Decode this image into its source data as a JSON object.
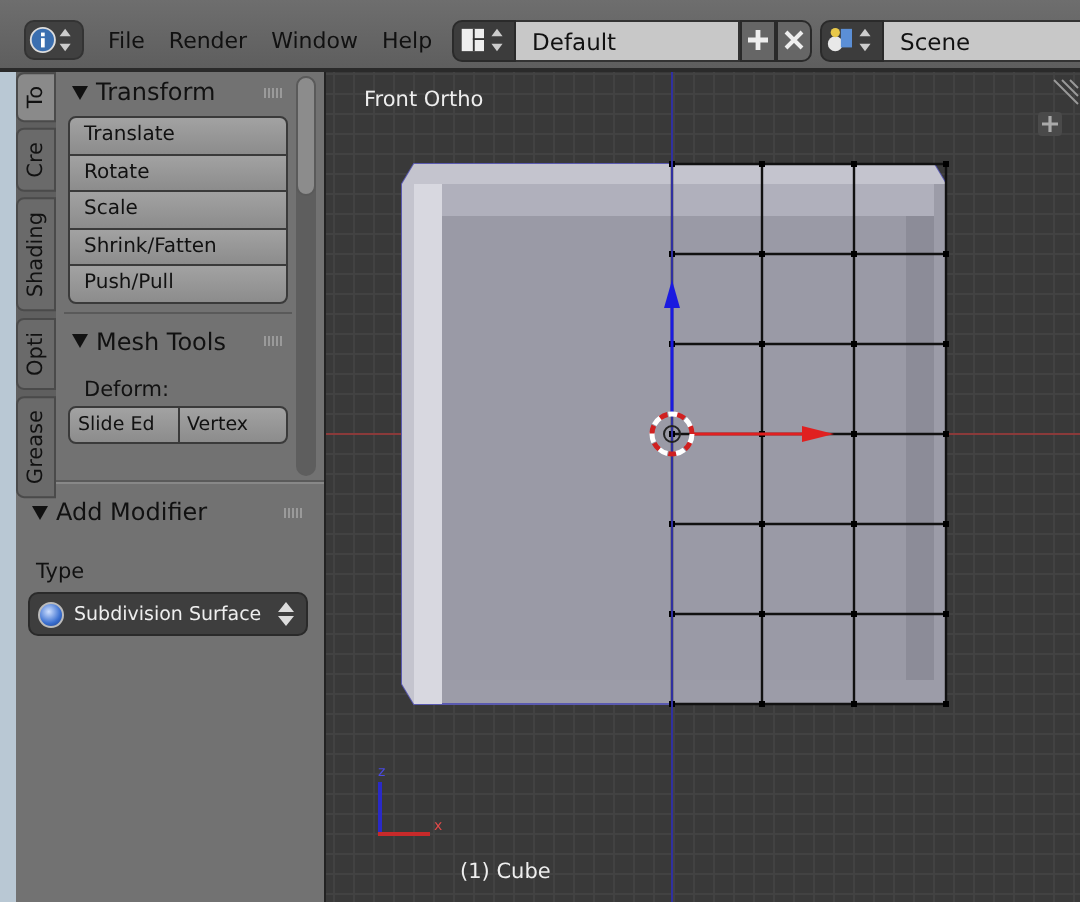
{
  "menu": {
    "items": [
      "File",
      "Render",
      "Window",
      "Help"
    ]
  },
  "layout_selector": {
    "value": "Default"
  },
  "scene_selector": {
    "value": "Scene"
  },
  "tool_tabs": [
    {
      "label": "To",
      "selected": true
    },
    {
      "label": "Cre",
      "selected": false
    },
    {
      "label": "Shading",
      "selected": false
    },
    {
      "label": "Opti",
      "selected": false
    },
    {
      "label": "Grease",
      "selected": false
    }
  ],
  "transform_panel": {
    "title": "Transform",
    "expanded": true,
    "buttons": [
      "Translate",
      "Rotate",
      "Scale",
      "Shrink/Fatten",
      "Push/Pull"
    ]
  },
  "mesh_tools_panel": {
    "title": "Mesh Tools",
    "expanded": true,
    "section_label": "Deform:",
    "buttons": [
      "Slide Ed",
      "Vertex"
    ]
  },
  "add_modifier_panel": {
    "title": "Add Modifier",
    "expanded": true,
    "type_label": "Type",
    "type_value": "Subdivision Surface"
  },
  "viewport": {
    "view_name": "Front Ortho",
    "object_label": "(1) Cube",
    "axis_labels": [
      "z",
      "x"
    ]
  }
}
